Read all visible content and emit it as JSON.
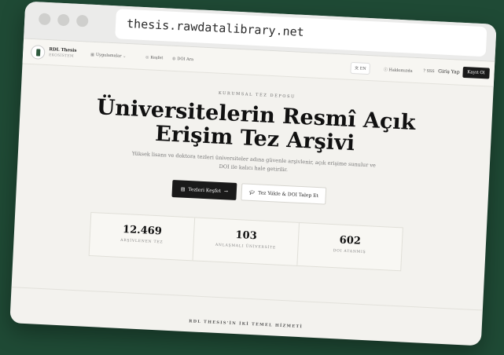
{
  "browser": {
    "url": "thesis.rawdatalibrary.net"
  },
  "nav": {
    "brand_name": "RDL Thesis",
    "brand_tagline": "EKOSİSTEM",
    "apps_label": "Uygulamalar",
    "explore_label": "Keşfet",
    "doi_label": "DOI Ara",
    "lang_label": "EN",
    "about_label": "Hakkımızda",
    "faq_label": "SSS",
    "login_label": "Giriş Yap",
    "register_label": "Kayıt Ol"
  },
  "hero": {
    "eyebrow": "KURUMSAL TEZ DEPOSU",
    "headline_line1": "Üniversitelerin Resmî Açık",
    "headline_line2": "Erişim Tez Arşivi",
    "subtitle": "Yüksek lisans ve doktora tezleri üniversiteler adına güvenle arşivlenir, açık erişime sunulur ve DOI ile kalıcı hale getirilir.",
    "primary_button": "Tezleri Keşfet",
    "secondary_button": "Tez Yükle & DOI Talep Et"
  },
  "stats": [
    {
      "value": "12.469",
      "label": "ARŞİVLENEN TEZ"
    },
    {
      "value": "103",
      "label": "ANLAŞMALI ÜNİVERSİTE"
    },
    {
      "value": "602",
      "label": "DOI ATANMIŞ"
    }
  ],
  "section": {
    "title": "RDL THESIS'İN İKİ TEMEL HİZMETİ"
  },
  "colors": {
    "background": "#1f4a35",
    "page": "#f3f2ee",
    "primary": "#1a1a1a"
  }
}
